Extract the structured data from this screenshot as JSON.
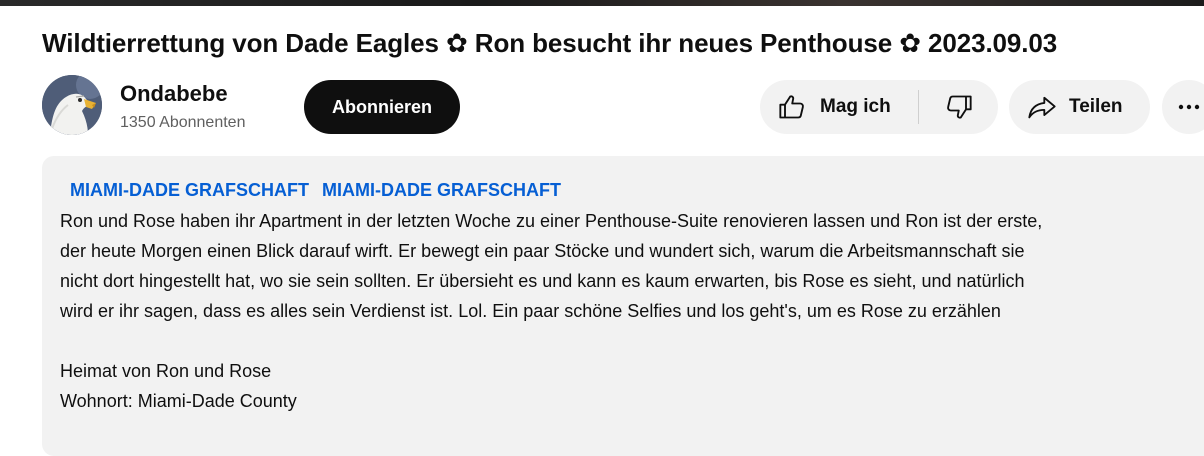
{
  "video": {
    "title": "Wildtierrettung von Dade Eagles ✿ Ron besucht ihr neues Penthouse ✿ 2023.09.03"
  },
  "channel": {
    "name": "Ondabebe",
    "subscribers": "1350 Abonnenten",
    "avatar_icon": "eagle-avatar"
  },
  "actions": {
    "subscribe_label": "Abonnieren",
    "like_label": "Mag ich",
    "share_label": "Teilen",
    "like_icon": "thumbs-up-icon",
    "dislike_icon": "thumbs-down-icon",
    "share_icon": "share-arrow-icon",
    "more_icon": "more-horizontal-icon"
  },
  "description": {
    "tags": [
      "MIAMI-DADE GRAFSCHAFT",
      "MIAMI-DADE GRAFSCHAFT"
    ],
    "lines": [
      "Ron und Rose haben ihr Apartment in der letzten Woche zu einer Penthouse-Suite renovieren lassen und Ron ist der erste,",
      "der heute Morgen einen Blick darauf wirft. Er bewegt ein paar Stöcke und wundert sich, warum die Arbeitsmannschaft sie",
      "nicht dort hingestellt hat, wo sie sein sollten. Er übersieht es und kann es kaum erwarten, bis Rose es sieht, und natürlich",
      "wird er ihr sagen, dass es alles sein Verdienst ist. Lol. Ein paar schöne Selfies und los geht's, um es Rose zu erzählen",
      "Heimat von Ron und Rose",
      "Wohnort: Miami-Dade County"
    ]
  },
  "colors": {
    "link": "#065fd4",
    "button_dark": "#0f0f0f",
    "chip_bg": "#f2f2f2",
    "secondary_text": "#606060"
  }
}
